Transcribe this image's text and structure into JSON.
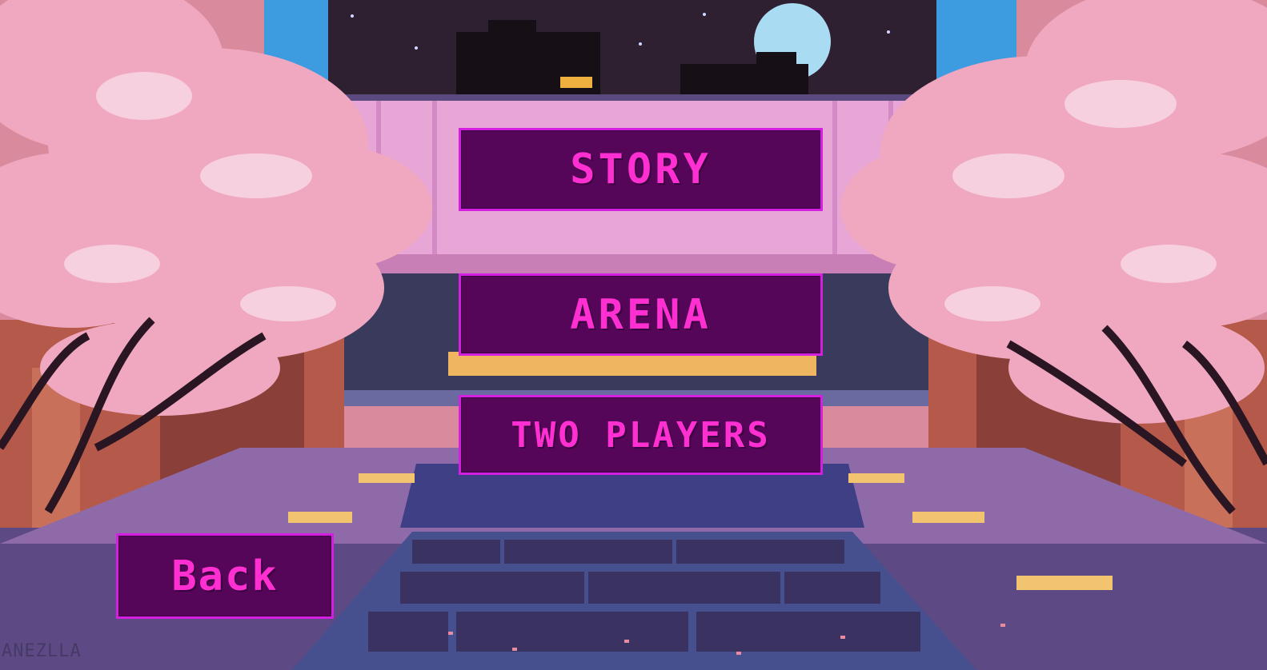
{
  "menu": {
    "story_label": "STORY",
    "arena_label": "ARENA",
    "two_players_label": "TWO PLAYERS",
    "back_label": "Back"
  },
  "watermark": "ANEZLLA",
  "colors": {
    "button_bg": "#560659",
    "button_border": "#d41ee0",
    "button_text": "#ff2fd2",
    "sky": "#2b1f35",
    "moon": "#a9dcf2",
    "blossom": "#f0a8c0"
  }
}
